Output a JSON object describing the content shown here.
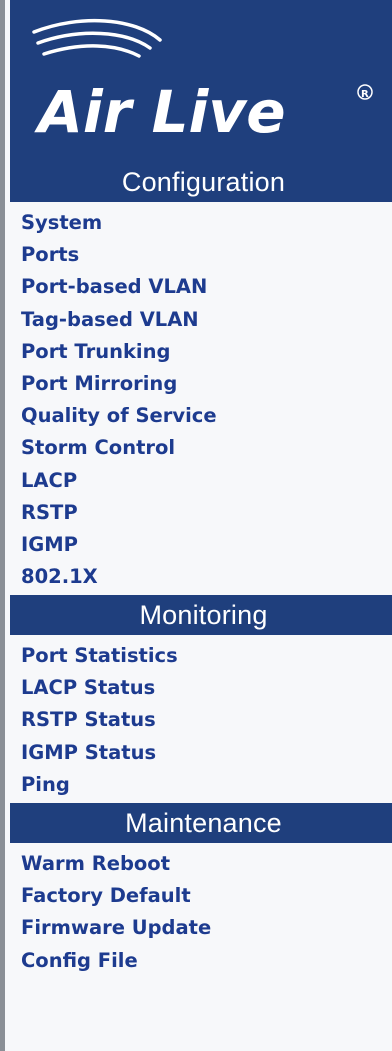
{
  "brand": {
    "logo_text": "Air Live",
    "colors": {
      "header_bg": "#1f3f7d",
      "link": "#1d3b8f",
      "panel_bg": "#f7f8fa"
    }
  },
  "sections": [
    {
      "title": "Configuration",
      "items": [
        "System",
        "Ports",
        "Port-based VLAN",
        "Tag-based VLAN",
        "Port Trunking",
        "Port Mirroring",
        "Quality of Service",
        "Storm Control",
        "LACP",
        "RSTP",
        "IGMP",
        "802.1X"
      ]
    },
    {
      "title": "Monitoring",
      "items": [
        "Port Statistics",
        "LACP Status",
        "RSTP Status",
        "IGMP Status",
        "Ping"
      ]
    },
    {
      "title": "Maintenance",
      "items": [
        "Warm Reboot",
        "Factory Default",
        "Firmware Update",
        "Config File"
      ]
    }
  ]
}
